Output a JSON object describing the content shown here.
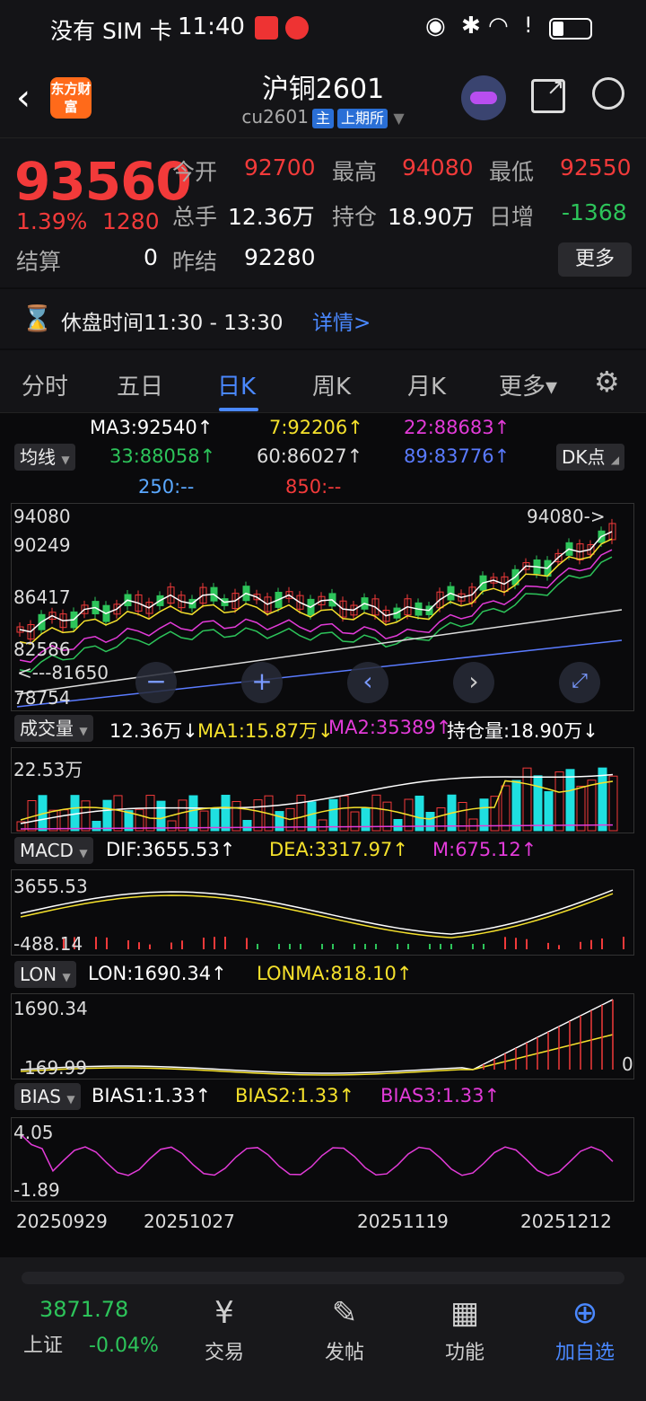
{
  "status_bar": {
    "carrier": "没有 SIM 卡",
    "time": "11:40"
  },
  "header": {
    "logo": "东方财富",
    "title": "沪铜2601",
    "code": "cu2601",
    "tag_main": "主",
    "tag_exchange": "上期所"
  },
  "quote": {
    "price": "93560",
    "change_pct": "1.39%",
    "change": "1280",
    "open_label": "今开",
    "open": "92700",
    "high_label": "最高",
    "high": "94080",
    "low_label": "最低",
    "low": "92550",
    "volume_label": "总手",
    "volume": "12.36万",
    "oi_label": "持仓",
    "oi": "18.90万",
    "daily_inc_label": "日增",
    "daily_inc": "-1368",
    "settle_label": "结算",
    "settle": "0",
    "prev_settle_label": "昨结",
    "prev_settle": "92280",
    "more_button": "更多"
  },
  "notice": {
    "text": "休盘时间11:30 - 13:30",
    "link": "详情>"
  },
  "tabs": [
    "分时",
    "五日",
    "日K",
    "周K",
    "月K",
    "更多▾"
  ],
  "active_tab": "日K",
  "ma": {
    "selector": "均线",
    "ma3": "MA3:92540↑",
    "ma7": "7:92206↑",
    "ma22": "22:88683↑",
    "ma33": "33:88058↑",
    "ma60": "60:86027↑",
    "ma89": "89:83776↑",
    "ma250": "250:--",
    "ma850": "850:--",
    "dk_button": "DK点"
  },
  "kline": {
    "axis": [
      "94080",
      "90249",
      "86417",
      "82586",
      "78754"
    ],
    "high_marker": "94080->",
    "low_marker": "<---81650",
    "td_labels_early": [
      "4",
      "5",
      "6",
      "7",
      "9"
    ],
    "td_labels_late": [
      "1",
      "2",
      "3",
      "4",
      "5",
      "6",
      "7",
      "8",
      "9"
    ]
  },
  "volume": {
    "selector": "成交量",
    "val": "12.36万↓",
    "ma1": "MA1:15.87万↓",
    "ma2": "MA2:35389↑",
    "oi": "持仓量:18.90万↓",
    "axis_top": "22.53万"
  },
  "macd": {
    "selector": "MACD",
    "dif": "DIF:3655.53↑",
    "dea": "DEA:3317.97↑",
    "m": "M:675.12↑",
    "axis_top": "3655.53",
    "axis_bottom": "-488.14"
  },
  "lon": {
    "selector": "LON",
    "lon": "LON:1690.34↑",
    "lonma": "LONMA:818.10↑",
    "axis_top": "1690.34",
    "axis_bottom": "169.99",
    "axis_right": "0"
  },
  "bias": {
    "selector": "BIAS",
    "b1": "BIAS1:1.33↑",
    "b2": "BIAS2:1.33↑",
    "b3": "BIAS3:1.33↑",
    "axis_top": "4.05",
    "axis_bottom": "-1.89"
  },
  "dates": [
    "20250929",
    "20251027",
    "20251119",
    "20251212"
  ],
  "bottom_nav": {
    "index_value": "3871.78",
    "index_name": "上证",
    "index_change": "-0.04%",
    "trade": "交易",
    "post": "发帖",
    "features": "功能",
    "add_watch": "加自选"
  },
  "colors": {
    "up": "#f23a3a",
    "down": "#2dc45a",
    "accent": "#4a88ff",
    "ma3": "#ffffff",
    "ma7": "#f5e12c",
    "ma22": "#e23bd8",
    "ma33": "#2dc45a",
    "ma60": "#dddddd",
    "ma89": "#5a7bff"
  }
}
